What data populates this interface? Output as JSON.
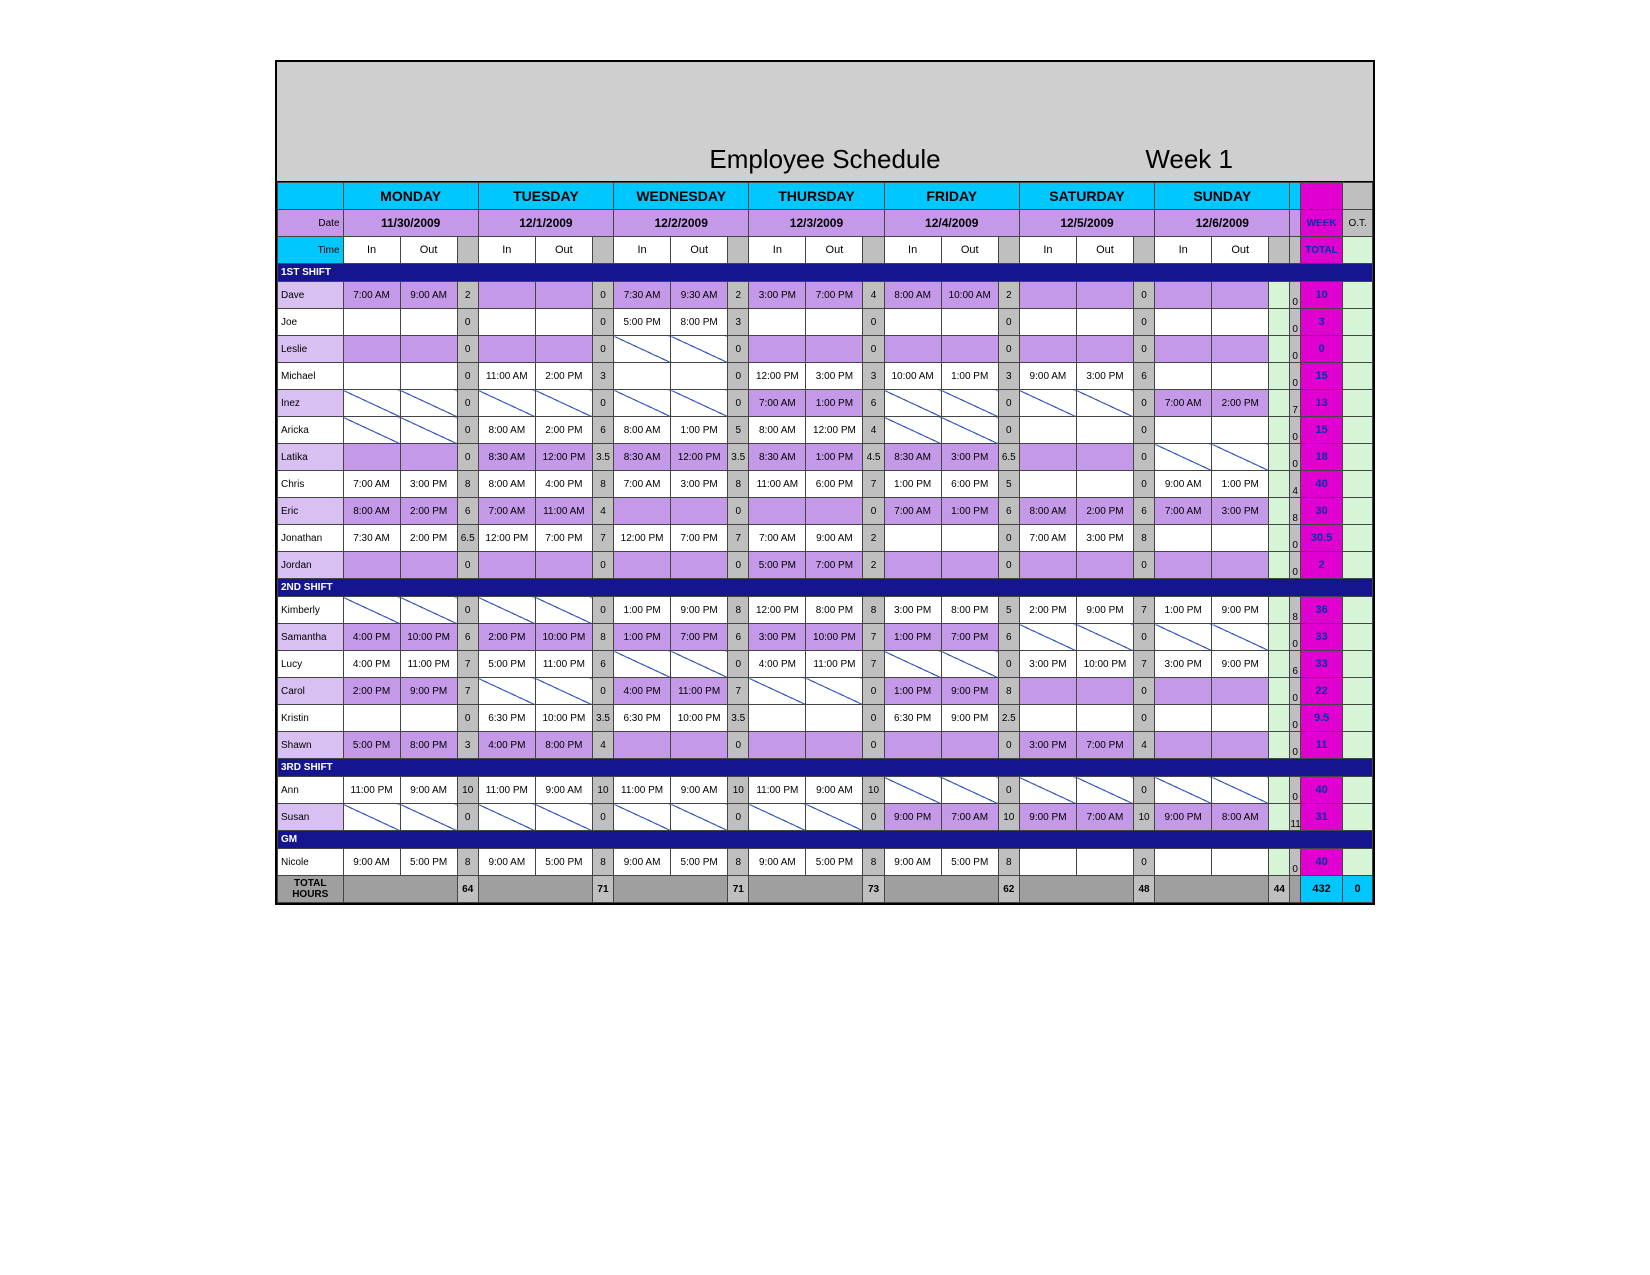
{
  "title": "Employee Schedule",
  "week_label": "Week 1",
  "header_labels": {
    "date": "Date",
    "time": "Time",
    "in": "In",
    "out": "Out",
    "week": "WEEK",
    "ot": "O.T.",
    "total": "TOTAL",
    "total_hours": "TOTAL HOURS"
  },
  "days": [
    {
      "name": "MONDAY",
      "date": "11/30/2009"
    },
    {
      "name": "TUESDAY",
      "date": "12/1/2009"
    },
    {
      "name": "WEDNESDAY",
      "date": "12/2/2009"
    },
    {
      "name": "THURSDAY",
      "date": "12/3/2009"
    },
    {
      "name": "FRIDAY",
      "date": "12/4/2009"
    },
    {
      "name": "SATURDAY",
      "date": "12/5/2009"
    },
    {
      "name": "SUNDAY",
      "date": "12/6/2009"
    }
  ],
  "shifts": [
    {
      "label": "1ST SHIFT",
      "rows": [
        {
          "name": "Dave",
          "shade": "purpleL",
          "week": "10",
          "days": [
            {
              "in": "7:00 AM",
              "out": "9:00 AM",
              "h": "2"
            },
            {
              "in": "",
              "out": "",
              "h": "0"
            },
            {
              "in": "7:30 AM",
              "out": "9:30 AM",
              "h": "2"
            },
            {
              "in": "3:00 PM",
              "out": "7:00 PM",
              "h": "4"
            },
            {
              "in": "8:00 AM",
              "out": "10:00 AM",
              "h": "2"
            },
            {
              "in": "",
              "out": "",
              "h": "0"
            },
            {
              "in": "",
              "out": "",
              "h": "",
              "sub": "0"
            }
          ]
        },
        {
          "name": "Joe",
          "shade": "white",
          "week": "3",
          "days": [
            {
              "in": "",
              "out": "",
              "h": "0"
            },
            {
              "in": "",
              "out": "",
              "h": "0"
            },
            {
              "in": "5:00 PM",
              "out": "8:00 PM",
              "h": "3"
            },
            {
              "in": "",
              "out": "",
              "h": "0"
            },
            {
              "in": "",
              "out": "",
              "h": "0"
            },
            {
              "in": "",
              "out": "",
              "h": "0"
            },
            {
              "in": "",
              "out": "",
              "h": "",
              "sub": "0"
            }
          ]
        },
        {
          "name": "Leslie",
          "shade": "purpleL",
          "week": "0",
          "days": [
            {
              "in": "",
              "out": "",
              "h": "0"
            },
            {
              "in": "",
              "out": "",
              "h": "0"
            },
            {
              "in": "/",
              "out": "/",
              "h": "0"
            },
            {
              "in": "",
              "out": "",
              "h": "0"
            },
            {
              "in": "",
              "out": "",
              "h": "0"
            },
            {
              "in": "",
              "out": "",
              "h": "0"
            },
            {
              "in": "",
              "out": "",
              "h": "",
              "sub": "0"
            }
          ]
        },
        {
          "name": "Michael",
          "shade": "white",
          "week": "15",
          "days": [
            {
              "in": "",
              "out": "",
              "h": "0"
            },
            {
              "in": "11:00 AM",
              "out": "2:00 PM",
              "h": "3"
            },
            {
              "in": "",
              "out": "",
              "h": "0"
            },
            {
              "in": "12:00 PM",
              "out": "3:00 PM",
              "h": "3"
            },
            {
              "in": "10:00 AM",
              "out": "1:00 PM",
              "h": "3"
            },
            {
              "in": "9:00 AM",
              "out": "3:00 PM",
              "h": "6"
            },
            {
              "in": "",
              "out": "",
              "h": "",
              "sub": "0"
            }
          ]
        },
        {
          "name": "Inez",
          "shade": "purpleL",
          "week": "13",
          "days": [
            {
              "in": "/",
              "out": "/",
              "h": "0"
            },
            {
              "in": "/",
              "out": "/",
              "h": "0"
            },
            {
              "in": "/",
              "out": "/",
              "h": "0"
            },
            {
              "in": "7:00 AM",
              "out": "1:00 PM",
              "h": "6"
            },
            {
              "in": "/",
              "out": "/",
              "h": "0"
            },
            {
              "in": "/",
              "out": "/",
              "h": "0"
            },
            {
              "in": "7:00 AM",
              "out": "2:00 PM",
              "h": "",
              "sub": "7"
            }
          ]
        },
        {
          "name": "Aricka",
          "shade": "white",
          "week": "15",
          "days": [
            {
              "in": "/",
              "out": "/",
              "h": "0"
            },
            {
              "in": "8:00 AM",
              "out": "2:00 PM",
              "h": "6"
            },
            {
              "in": "8:00 AM",
              "out": "1:00 PM",
              "h": "5"
            },
            {
              "in": "8:00 AM",
              "out": "12:00 PM",
              "h": "4"
            },
            {
              "in": "/",
              "out": "/",
              "h": "0"
            },
            {
              "in": "",
              "out": "",
              "h": "0"
            },
            {
              "in": "",
              "out": "",
              "h": "",
              "sub": "0"
            }
          ]
        },
        {
          "name": "Latika",
          "shade": "purpleL",
          "week": "18",
          "days": [
            {
              "in": "",
              "out": "",
              "h": "0"
            },
            {
              "in": "8:30 AM",
              "out": "12:00 PM",
              "h": "3.5"
            },
            {
              "in": "8:30 AM",
              "out": "12:00 PM",
              "h": "3.5"
            },
            {
              "in": "8:30 AM",
              "out": "1:00 PM",
              "h": "4.5"
            },
            {
              "in": "8:30 AM",
              "out": "3:00 PM",
              "h": "6.5"
            },
            {
              "in": "",
              "out": "",
              "h": "0"
            },
            {
              "in": "/",
              "out": "/",
              "h": "",
              "sub": "0"
            }
          ]
        },
        {
          "name": "Chris",
          "shade": "white",
          "week": "40",
          "days": [
            {
              "in": "7:00 AM",
              "out": "3:00 PM",
              "h": "8"
            },
            {
              "in": "8:00 AM",
              "out": "4:00 PM",
              "h": "8"
            },
            {
              "in": "7:00 AM",
              "out": "3:00 PM",
              "h": "8"
            },
            {
              "in": "11:00 AM",
              "out": "6:00 PM",
              "h": "7"
            },
            {
              "in": "1:00 PM",
              "out": "6:00 PM",
              "h": "5"
            },
            {
              "in": "",
              "out": "",
              "h": "0"
            },
            {
              "in": "9:00 AM",
              "out": "1:00 PM",
              "h": "",
              "sub": "4"
            }
          ]
        },
        {
          "name": "Eric",
          "shade": "purpleL",
          "week": "30",
          "days": [
            {
              "in": "8:00 AM",
              "out": "2:00 PM",
              "h": "6"
            },
            {
              "in": "7:00 AM",
              "out": "11:00 AM",
              "h": "4"
            },
            {
              "in": "",
              "out": "",
              "h": "0"
            },
            {
              "in": "",
              "out": "",
              "h": "0"
            },
            {
              "in": "7:00 AM",
              "out": "1:00 PM",
              "h": "6"
            },
            {
              "in": "8:00 AM",
              "out": "2:00 PM",
              "h": "6"
            },
            {
              "in": "7:00 AM",
              "out": "3:00 PM",
              "h": "",
              "sub": "8"
            }
          ]
        },
        {
          "name": "Jonathan",
          "shade": "white",
          "week": "30.5",
          "days": [
            {
              "in": "7:30 AM",
              "out": "2:00 PM",
              "h": "6.5"
            },
            {
              "in": "12:00 PM",
              "out": "7:00 PM",
              "h": "7"
            },
            {
              "in": "12:00 PM",
              "out": "7:00 PM",
              "h": "7"
            },
            {
              "in": "7:00 AM",
              "out": "9:00 AM",
              "h": "2"
            },
            {
              "in": "",
              "out": "",
              "h": "0"
            },
            {
              "in": "7:00 AM",
              "out": "3:00 PM",
              "h": "8"
            },
            {
              "in": "",
              "out": "",
              "h": "",
              "sub": "0"
            }
          ]
        },
        {
          "name": "Jordan",
          "shade": "purpleL",
          "week": "2",
          "days": [
            {
              "in": "",
              "out": "",
              "h": "0"
            },
            {
              "in": "",
              "out": "",
              "h": "0"
            },
            {
              "in": "",
              "out": "",
              "h": "0"
            },
            {
              "in": "5:00 PM",
              "out": "7:00 PM",
              "h": "2"
            },
            {
              "in": "",
              "out": "",
              "h": "0"
            },
            {
              "in": "",
              "out": "",
              "h": "0"
            },
            {
              "in": "",
              "out": "",
              "h": "",
              "sub": "0"
            }
          ]
        }
      ]
    },
    {
      "label": "2ND SHIFT",
      "rows": [
        {
          "name": "Kimberly",
          "shade": "white",
          "week": "36",
          "days": [
            {
              "in": "/",
              "out": "/",
              "h": "0"
            },
            {
              "in": "/",
              "out": "/",
              "h": "0"
            },
            {
              "in": "1:00 PM",
              "out": "9:00 PM",
              "h": "8"
            },
            {
              "in": "12:00 PM",
              "out": "8:00 PM",
              "h": "8"
            },
            {
              "in": "3:00 PM",
              "out": "8:00 PM",
              "h": "5"
            },
            {
              "in": "2:00 PM",
              "out": "9:00 PM",
              "h": "7"
            },
            {
              "in": "1:00 PM",
              "out": "9:00 PM",
              "h": "",
              "sub": "8"
            }
          ]
        },
        {
          "name": "Samantha",
          "shade": "purpleL",
          "week": "33",
          "days": [
            {
              "in": "4:00 PM",
              "out": "10:00 PM",
              "h": "6"
            },
            {
              "in": "2:00 PM",
              "out": "10:00 PM",
              "h": "8"
            },
            {
              "in": "1:00 PM",
              "out": "7:00 PM",
              "h": "6"
            },
            {
              "in": "3:00 PM",
              "out": "10:00 PM",
              "h": "7"
            },
            {
              "in": "1:00 PM",
              "out": "7:00 PM",
              "h": "6"
            },
            {
              "in": "/",
              "out": "/",
              "h": "0"
            },
            {
              "in": "/",
              "out": "/",
              "h": "",
              "sub": "0"
            }
          ]
        },
        {
          "name": "Lucy",
          "shade": "white",
          "week": "33",
          "days": [
            {
              "in": "4:00 PM",
              "out": "11:00 PM",
              "h": "7"
            },
            {
              "in": "5:00 PM",
              "out": "11:00 PM",
              "h": "6"
            },
            {
              "in": "/",
              "out": "/",
              "h": "0"
            },
            {
              "in": "4:00 PM",
              "out": "11:00 PM",
              "h": "7"
            },
            {
              "in": "/",
              "out": "/",
              "h": "0"
            },
            {
              "in": "3:00 PM",
              "out": "10:00 PM",
              "h": "7"
            },
            {
              "in": "3:00 PM",
              "out": "9:00 PM",
              "h": "",
              "sub": "6"
            }
          ]
        },
        {
          "name": "Carol",
          "shade": "purpleL",
          "week": "22",
          "days": [
            {
              "in": "2:00 PM",
              "out": "9:00 PM",
              "h": "7"
            },
            {
              "in": "/",
              "out": "/",
              "h": "0"
            },
            {
              "in": "4:00 PM",
              "out": "11:00 PM",
              "h": "7"
            },
            {
              "in": "/",
              "out": "/",
              "h": "0"
            },
            {
              "in": "1:00 PM",
              "out": "9:00 PM",
              "h": "8"
            },
            {
              "in": "",
              "out": "",
              "h": "0"
            },
            {
              "in": "",
              "out": "",
              "h": "",
              "sub": "0"
            }
          ]
        },
        {
          "name": "Kristin",
          "shade": "white",
          "week": "9.5",
          "days": [
            {
              "in": "",
              "out": "",
              "h": "0"
            },
            {
              "in": "6:30 PM",
              "out": "10:00 PM",
              "h": "3.5"
            },
            {
              "in": "6:30 PM",
              "out": "10:00 PM",
              "h": "3.5"
            },
            {
              "in": "",
              "out": "",
              "h": "0"
            },
            {
              "in": "6:30 PM",
              "out": "9:00 PM",
              "h": "2.5"
            },
            {
              "in": "",
              "out": "",
              "h": "0"
            },
            {
              "in": "",
              "out": "",
              "h": "",
              "sub": "0"
            }
          ]
        },
        {
          "name": "Shawn",
          "shade": "purpleL",
          "week": "11",
          "days": [
            {
              "in": "5:00 PM",
              "out": "8:00 PM",
              "h": "3"
            },
            {
              "in": "4:00 PM",
              "out": "8:00 PM",
              "h": "4"
            },
            {
              "in": "",
              "out": "",
              "h": "0"
            },
            {
              "in": "",
              "out": "",
              "h": "0"
            },
            {
              "in": "",
              "out": "",
              "h": "0"
            },
            {
              "in": "3:00 PM",
              "out": "7:00 PM",
              "h": "4"
            },
            {
              "in": "",
              "out": "",
              "h": "",
              "sub": "0"
            }
          ]
        }
      ]
    },
    {
      "label": "3RD SHIFT",
      "rows": [
        {
          "name": "Ann",
          "shade": "white",
          "week": "40",
          "days": [
            {
              "in": "11:00 PM",
              "out": "9:00 AM",
              "h": "10"
            },
            {
              "in": "11:00 PM",
              "out": "9:00 AM",
              "h": "10"
            },
            {
              "in": "11:00 PM",
              "out": "9:00 AM",
              "h": "10"
            },
            {
              "in": "11:00 PM",
              "out": "9:00 AM",
              "h": "10"
            },
            {
              "in": "/",
              "out": "/",
              "h": "0"
            },
            {
              "in": "/",
              "out": "/",
              "h": "0"
            },
            {
              "in": "/",
              "out": "/",
              "h": "",
              "sub": "0"
            }
          ]
        },
        {
          "name": "Susan",
          "shade": "purpleL",
          "week": "31",
          "days": [
            {
              "in": "/",
              "out": "/",
              "h": "0"
            },
            {
              "in": "/",
              "out": "/",
              "h": "0"
            },
            {
              "in": "/",
              "out": "/",
              "h": "0"
            },
            {
              "in": "/",
              "out": "/",
              "h": "0"
            },
            {
              "in": "9:00 PM",
              "out": "7:00 AM",
              "h": "10"
            },
            {
              "in": "9:00 PM",
              "out": "7:00 AM",
              "h": "10"
            },
            {
              "in": "9:00 PM",
              "out": "8:00 AM",
              "h": "",
              "sub": "11"
            }
          ]
        }
      ]
    },
    {
      "label": "GM",
      "rows": [
        {
          "name": "Nicole",
          "shade": "white",
          "week": "40",
          "days": [
            {
              "in": "9:00 AM",
              "out": "5:00 PM",
              "h": "8"
            },
            {
              "in": "9:00 AM",
              "out": "5:00 PM",
              "h": "8"
            },
            {
              "in": "9:00 AM",
              "out": "5:00 PM",
              "h": "8"
            },
            {
              "in": "9:00 AM",
              "out": "5:00 PM",
              "h": "8"
            },
            {
              "in": "9:00 AM",
              "out": "5:00 PM",
              "h": "8"
            },
            {
              "in": "",
              "out": "",
              "h": "0"
            },
            {
              "in": "",
              "out": "",
              "h": "",
              "sub": "0"
            }
          ]
        }
      ]
    }
  ],
  "totals": {
    "day": [
      "64",
      "71",
      "71",
      "73",
      "62",
      "48",
      "44"
    ],
    "week": "432",
    "ot": "0"
  }
}
